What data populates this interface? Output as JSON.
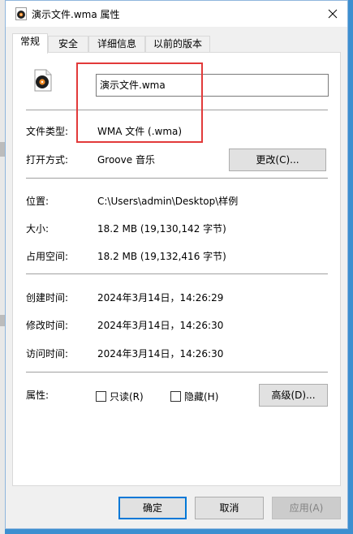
{
  "window": {
    "title": "演示文件.wma 属性",
    "close_icon": "close-icon"
  },
  "tabs": [
    {
      "label": "常规",
      "active": true
    },
    {
      "label": "安全"
    },
    {
      "label": "详细信息"
    },
    {
      "label": "以前的版本"
    }
  ],
  "general": {
    "file_name": "演示文件.wma",
    "file_type_label": "文件类型:",
    "file_type_value": "WMA 文件 (.wma)",
    "open_with_label": "打开方式:",
    "open_with_value": "Groove 音乐",
    "change_button": "更改(C)...",
    "location_label": "位置:",
    "location_value": "C:\\Users\\admin\\Desktop\\样例",
    "size_label": "大小:",
    "size_value": "18.2 MB (19,130,142 字节)",
    "size_on_disk_label": "占用空间:",
    "size_on_disk_value": "18.2 MB (19,132,416 字节)",
    "created_label": "创建时间:",
    "created_value": "2024年3月14日，14:26:29",
    "modified_label": "修改时间:",
    "modified_value": "2024年3月14日，14:26:30",
    "accessed_label": "访问时间:",
    "accessed_value": "2024年3月14日，14:26:30",
    "attributes_label": "属性:",
    "readonly_label": "只读(R)",
    "hidden_label": "隐藏(H)",
    "advanced_button": "高级(D)..."
  },
  "footer": {
    "ok": "确定",
    "cancel": "取消",
    "apply": "应用(A)"
  },
  "colors": {
    "highlight_box": "#e23a3a",
    "default_button_border": "#0078d7"
  }
}
